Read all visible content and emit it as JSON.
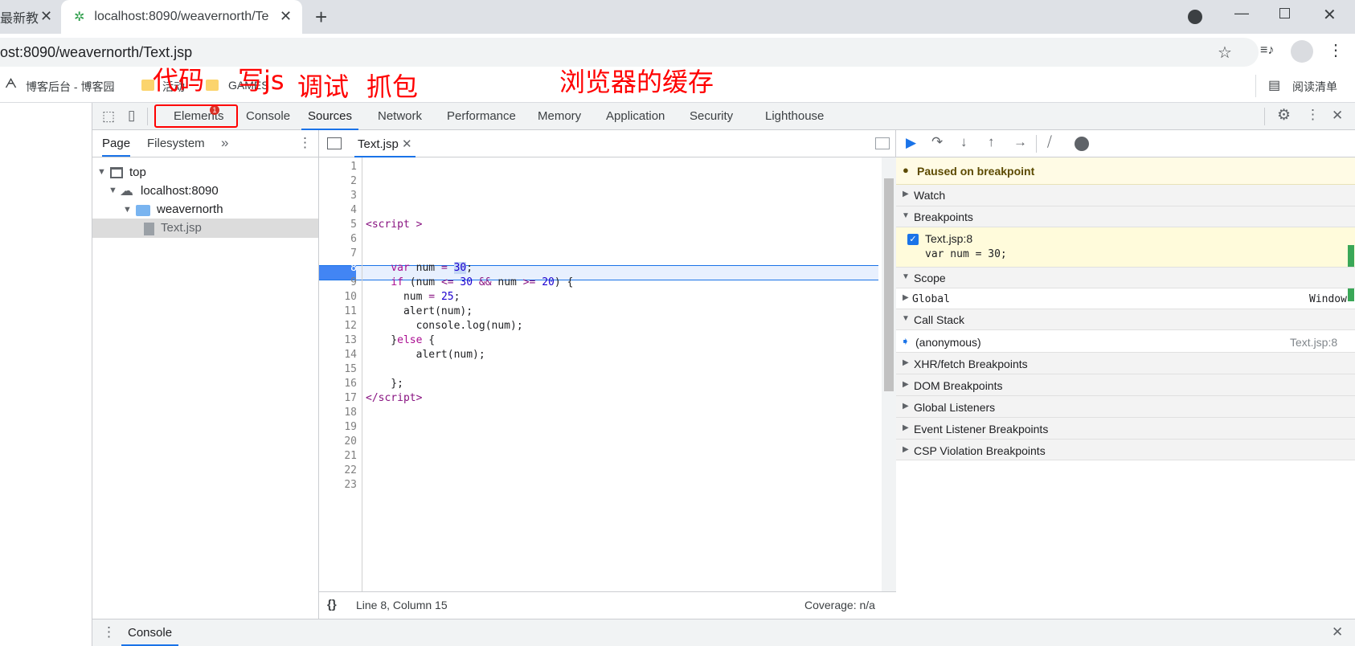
{
  "browser": {
    "tabs": [
      {
        "title": "最新教",
        "close": "✕"
      },
      {
        "title": "localhost:8090/weavernorth/Te",
        "close": "✕"
      }
    ],
    "new_tab": "+",
    "url": "ost:8090/weavernorth/Text.jsp",
    "bookmarks": [
      {
        "label": "博客后台 - 博客园"
      },
      {
        "label": "活动"
      },
      {
        "label": "GAMES"
      }
    ],
    "reading_list": "阅读清单"
  },
  "annotations": [
    "代码",
    "写js",
    "调试",
    "抓包",
    "浏览器的缓存"
  ],
  "devtools": {
    "tabs": [
      "Elements",
      "Console",
      "Sources",
      "Network",
      "Performance",
      "Memory",
      "Application",
      "Security",
      "Lighthouse"
    ],
    "active_tab": "Sources",
    "elements_badge": "1",
    "navigator": {
      "tabs": [
        "Page",
        "Filesystem"
      ],
      "tree": [
        "top",
        "localhost:8090",
        "weavernorth",
        "Text.jsp"
      ]
    },
    "editor": {
      "file_tab": "Text.jsp",
      "line_numbers": [
        "1",
        "2",
        "3",
        "4",
        "5",
        "6",
        "7",
        "8",
        "9",
        "10",
        "11",
        "12",
        "13",
        "14",
        "15",
        "16",
        "17",
        "18",
        "19",
        "20",
        "21",
        "22",
        "23"
      ],
      "status_position": "Line 8, Column 15",
      "coverage": "Coverage: n/a",
      "format_icon": "{}"
    },
    "debugger": {
      "paused": "Paused on breakpoint",
      "watch": "Watch",
      "breakpoints": "Breakpoints",
      "bp_file": "Text.jsp:8",
      "bp_code": "var num = 30;",
      "scope": "Scope",
      "global": "Global",
      "window": "Window",
      "call_stack": "Call Stack",
      "frame": "(anonymous)",
      "frame_loc": "Text.jsp:8",
      "sections": [
        "XHR/fetch Breakpoints",
        "DOM Breakpoints",
        "Global Listeners",
        "Event Listener Breakpoints",
        "CSP Violation Breakpoints"
      ]
    },
    "drawer_tab": "Console"
  }
}
